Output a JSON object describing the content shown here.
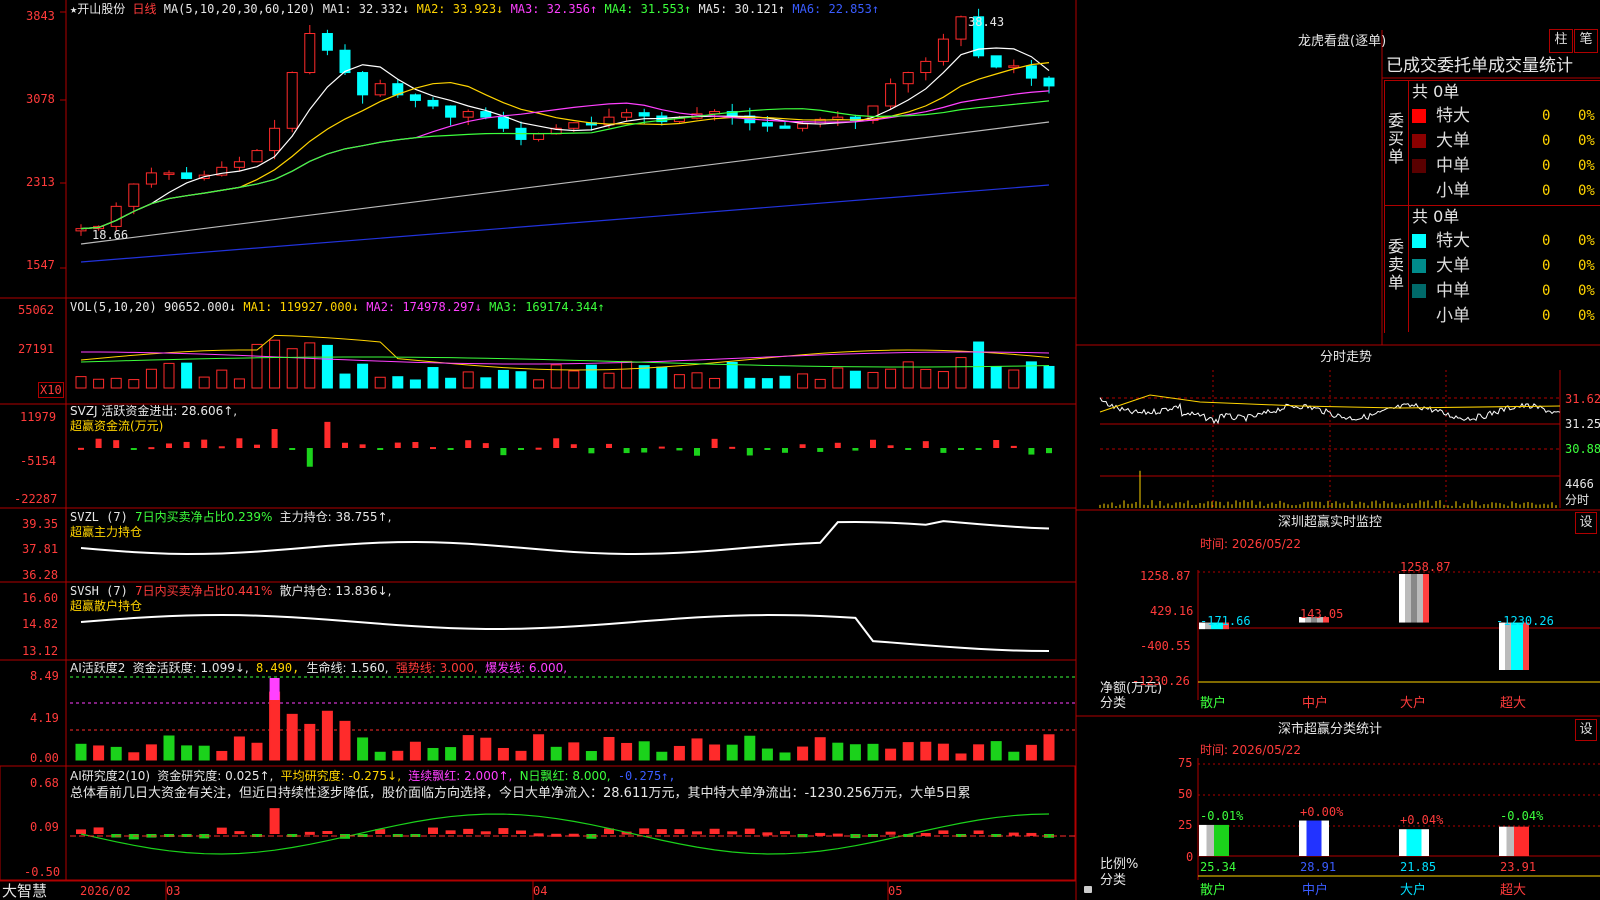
{
  "title": {
    "star": "★",
    "stock": "开山股份",
    "period": "日线",
    "ma_label": "MA(5,10,20,30,60,120)",
    "ma1": "MA1: 32.332↓",
    "ma2": "MA2: 33.923↓",
    "ma3": "MA3: 32.356↑",
    "ma4": "MA4: 31.553↑",
    "ma5": "MA5: 30.121↑",
    "ma6": "MA6: 22.853↑"
  },
  "price_axis": [
    "3843",
    "3078",
    "2313",
    "1547"
  ],
  "price_marks": {
    "high": "38.43",
    "low": "18.66"
  },
  "vol": {
    "label": "VOL(5,10,20)",
    "v": "90652.000↓",
    "ma1": "MA1: 119927.000↓",
    "ma2": "MA2: 174978.297↓",
    "ma3": "MA3: 169174.344↑",
    "axis": [
      "55062",
      "27191"
    ],
    "unit": "X10"
  },
  "svzj": {
    "l1": "SVZJ  活跃资金进出: 28.606↑,",
    "l2": "超赢资金流(万元)",
    "axis": [
      "11979",
      "-5154",
      "-22287"
    ]
  },
  "svzl": {
    "l1": "SVZL (7)",
    "l2": "7日内买卖净占比0.239%",
    "l3": "主力持仓: 38.755↑,",
    "l4": "超赢主力持仓",
    "axis": [
      "39.35",
      "37.81",
      "36.28"
    ]
  },
  "svsh": {
    "l1": "SVSH (7)",
    "l2": "7日内买卖净占比0.441%",
    "l3": "散户持仓: 13.836↓,",
    "l4": "超赢散户持仓",
    "axis": [
      "16.60",
      "14.82",
      "13.12"
    ]
  },
  "ai1": {
    "l1": "AI活跃度2",
    "l2": "资金活跃度: 1.099↓,",
    "l3": "8.490,",
    "l4": "生命线: 1.560,",
    "l5": "强势线: 3.000,",
    "l6": "爆发线: 6.000,",
    "axis": [
      "8.49",
      "4.19",
      "0.00"
    ]
  },
  "ai2": {
    "l1": "AI研究度2(10)",
    "l2": "资金研究度: 0.025↑,",
    "l3": "平均研究度: -0.275↓,",
    "l4": "连续飘红: 2.000↑,",
    "l5": "N日飘红: 8.000,",
    "l6": "-0.275↑,",
    "note": "总体看前几日大资金有关注，但近日持续性逐步降低，股价面临方向选择，今日大单净流入：28.611万元，其中特大单净流出：-1230.256万元，大单5日累",
    "axis": [
      "0.68",
      "0.09",
      "-0.50"
    ]
  },
  "bottom": {
    "brand": "大智慧",
    "dates": [
      "2026/02",
      "03",
      "04",
      "05"
    ]
  },
  "lhb": {
    "title": "龙虎看盘(逐单)",
    "btn1": "柱",
    "btn2": "笔",
    "sub": "已成交委托单成交量统计",
    "buy_label": "委买单",
    "sell_label": "委卖单",
    "buy_total": "共 0单",
    "sell_total": "共 0单",
    "buy": [
      {
        "name": "特大",
        "n": "0",
        "p": "0%",
        "c": "#ff0000"
      },
      {
        "name": "大单",
        "n": "0",
        "p": "0%",
        "c": "#8b0000"
      },
      {
        "name": "中单",
        "n": "0",
        "p": "0%",
        "c": "#5a0000"
      },
      {
        "name": "小单",
        "n": "0",
        "p": "0%",
        "c": ""
      }
    ],
    "sell": [
      {
        "name": "特大",
        "n": "0",
        "p": "0%",
        "c": "#00ffff"
      },
      {
        "name": "大单",
        "n": "0",
        "p": "0%",
        "c": "#008b8b"
      },
      {
        "name": "中单",
        "n": "0",
        "p": "0%",
        "c": "#006a6a"
      },
      {
        "name": "小单",
        "n": "0",
        "p": "0%",
        "c": ""
      }
    ]
  },
  "fenshi": {
    "title": "分时走势",
    "axis": [
      "31.62",
      "31.25",
      "30.88"
    ],
    "vol": "4466",
    "unit": "分时"
  },
  "sz_rt": {
    "title": "深圳超赢实时监控",
    "btn": "设",
    "time": "时间: 2026/05/22",
    "axis": [
      "1258.87",
      "429.16",
      "-400.55",
      "-1230.26"
    ],
    "ylabel": "净额(万元)",
    "xlabel": "分类",
    "cats": [
      "散户",
      "中户",
      "大户",
      "超大"
    ],
    "labels": [
      "-171.66",
      "143.05",
      "1258.87",
      "-1230.26"
    ]
  },
  "sz_cls": {
    "title": "深市超赢分类统计",
    "btn": "设",
    "time": "时间: 2026/05/22",
    "axis": [
      "75",
      "50",
      "25",
      "0"
    ],
    "ylabel": "比例%",
    "xlabel": "分类",
    "cats": [
      "散户",
      "中户",
      "大户",
      "超大"
    ],
    "top": [
      "-0.01%",
      "+0.00%",
      "+0.04%",
      "-0.04%"
    ],
    "vals": [
      "25.34",
      "28.91",
      "21.85",
      "23.91"
    ]
  },
  "chart_data": [
    {
      "type": "bar",
      "title": "深圳超赢实时监控",
      "categories": [
        "散户",
        "中户",
        "大户",
        "超大"
      ],
      "values": [
        -171.66,
        143.05,
        1258.87,
        -1230.26
      ],
      "ylim": [
        -1230.26,
        1258.87
      ],
      "ylabel": "净额(万元)",
      "xlabel": "分类"
    },
    {
      "type": "bar",
      "title": "深市超赢分类统计",
      "categories": [
        "散户",
        "中户",
        "大户",
        "超大"
      ],
      "values": [
        25.34,
        28.91,
        21.85,
        23.91
      ],
      "ylim": [
        0,
        75
      ],
      "ylabel": "比例%",
      "xlabel": "分类"
    }
  ]
}
